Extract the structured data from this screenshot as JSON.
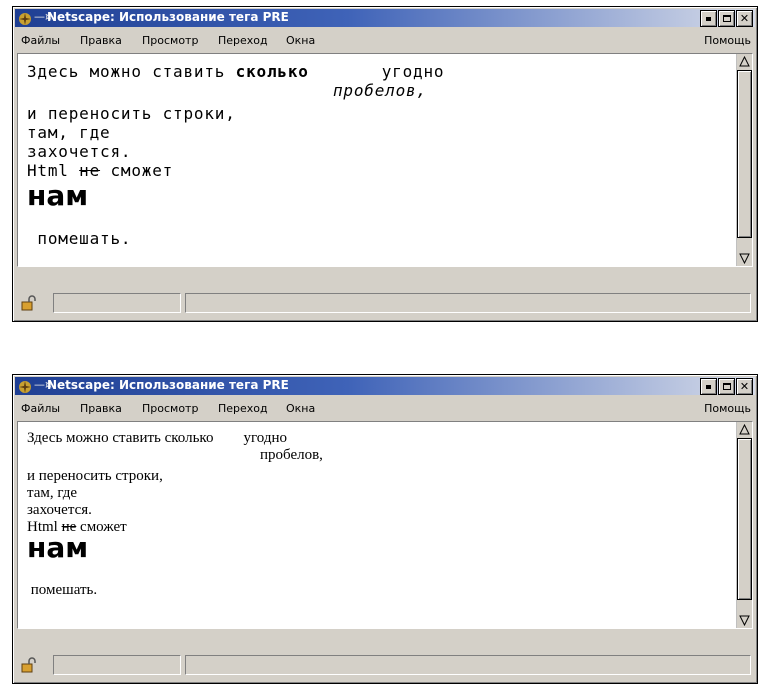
{
  "windows": [
    {
      "title": "Netscape: Использование тега PRE",
      "menu": {
        "items": [
          "Файлы",
          "Правка",
          "Просмотр",
          "Переход",
          "Окна"
        ],
        "help": "Помощь"
      },
      "pre": {
        "line1_a": "Здесь можно ставить ",
        "line1_bold": "сколько",
        "line1_c": "       угодно",
        "line2": "пробелов,",
        "line3": "и переносить строки,",
        "line4": "там, где",
        "line5": "захочется.",
        "line6_a": "Html ",
        "line6_strike": "не",
        "line6_c": " сможет",
        "line7": "нам",
        "line8": " помешать."
      }
    },
    {
      "title": "Netscape: Использование тега PRE",
      "menu": {
        "items": [
          "Файлы",
          "Правка",
          "Просмотр",
          "Переход",
          "Окна"
        ],
        "help": "Помощь"
      },
      "pre": {
        "line1_a": "Здесь можно ставить ",
        "line1_bold": "сколько",
        "line1_c": "        угодно",
        "line2": "пробелов,",
        "line3": "и переносить строки,",
        "line4": "там, где",
        "line5": "захочется.",
        "line6_a": "Html ",
        "line6_strike": "не",
        "line6_c": " сможет",
        "line7": "нам",
        "line8": " помешать."
      }
    }
  ],
  "icons": [
    "netscape-logo-icon",
    "pin-icon",
    "minimize-icon",
    "maximize-icon",
    "close-icon",
    "scroll-up-icon",
    "scroll-down-icon",
    "security-lock-icon"
  ],
  "colors": {
    "title_start": "#1f3f93",
    "title_end": "#d7dce9",
    "chrome": "#d4d0c8"
  }
}
